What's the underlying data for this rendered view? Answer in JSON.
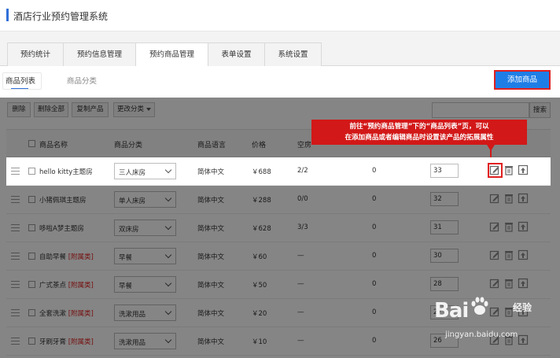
{
  "app": {
    "title": "酒店行业预约管理系统"
  },
  "tabs": [
    {
      "label": "预约统计",
      "active": false
    },
    {
      "label": "预约信息管理",
      "active": false
    },
    {
      "label": "预约商品管理",
      "active": true
    },
    {
      "label": "表单设置",
      "active": false
    },
    {
      "label": "系统设置",
      "active": false
    }
  ],
  "subtabs": [
    {
      "label": "商品列表",
      "active": true
    },
    {
      "label": "商品分类",
      "active": false
    }
  ],
  "add_button": "添加商品",
  "toolbar": {
    "delete": "删除",
    "delete_all": "删除全部",
    "copy": "复制产品",
    "change_category": "更改分类",
    "search": "搜索",
    "search_value": ""
  },
  "table": {
    "headers": [
      "商品名称",
      "商品分类",
      "商品语言",
      "价格",
      "空房"
    ],
    "rows": [
      {
        "name": "hello kitty主题房",
        "attach": "",
        "category": "三人床房",
        "lang": "简体中文",
        "price": "￥688",
        "rooms": "2/2",
        "count": "0",
        "sort": "33"
      },
      {
        "name": "小猪佩琪主题房",
        "attach": "",
        "category": "单人床房",
        "lang": "简体中文",
        "price": "￥288",
        "rooms": "0/0",
        "count": "0",
        "sort": "32"
      },
      {
        "name": "哆啦A梦主题房",
        "attach": "",
        "category": "双床房",
        "lang": "简体中文",
        "price": "￥628",
        "rooms": "3/3",
        "count": "0",
        "sort": "31"
      },
      {
        "name": "自助早餐",
        "attach": "[附属类]",
        "category": "早餐",
        "lang": "简体中文",
        "price": "￥60",
        "rooms": "—",
        "count": "0",
        "sort": "30"
      },
      {
        "name": "广式茶点",
        "attach": "[附属类]",
        "category": "早餐",
        "lang": "简体中文",
        "price": "￥50",
        "rooms": "—",
        "count": "0",
        "sort": "28"
      },
      {
        "name": "全套洗漱",
        "attach": "[附属类]",
        "category": "洗漱用品",
        "lang": "简体中文",
        "price": "￥20",
        "rooms": "—",
        "count": "0",
        "sort": "27"
      },
      {
        "name": "牙刷牙膏",
        "attach": "[附属类]",
        "category": "洗漱用品",
        "lang": "简体中文",
        "price": "￥10",
        "rooms": "—",
        "count": "0",
        "sort": "26"
      }
    ]
  },
  "callout": {
    "line1": "前往“预约商品管理”下的“商品列表”页，可以",
    "line2": "在添加商品或者编辑商品时设置该产品的拓展属性"
  },
  "watermark": {
    "logo": "Bai",
    "suffix": "经验",
    "url": "jingyan.baidu.com"
  },
  "colors": {
    "accent": "#2f6fd8",
    "button": "#1f7ee6",
    "highlight": "#e02020",
    "callout": "#d21818"
  },
  "icons": {
    "edit": "edit-icon",
    "delete": "trash-icon",
    "move_top": "arrow-up-icon",
    "drag": "drag-handle-icon"
  }
}
